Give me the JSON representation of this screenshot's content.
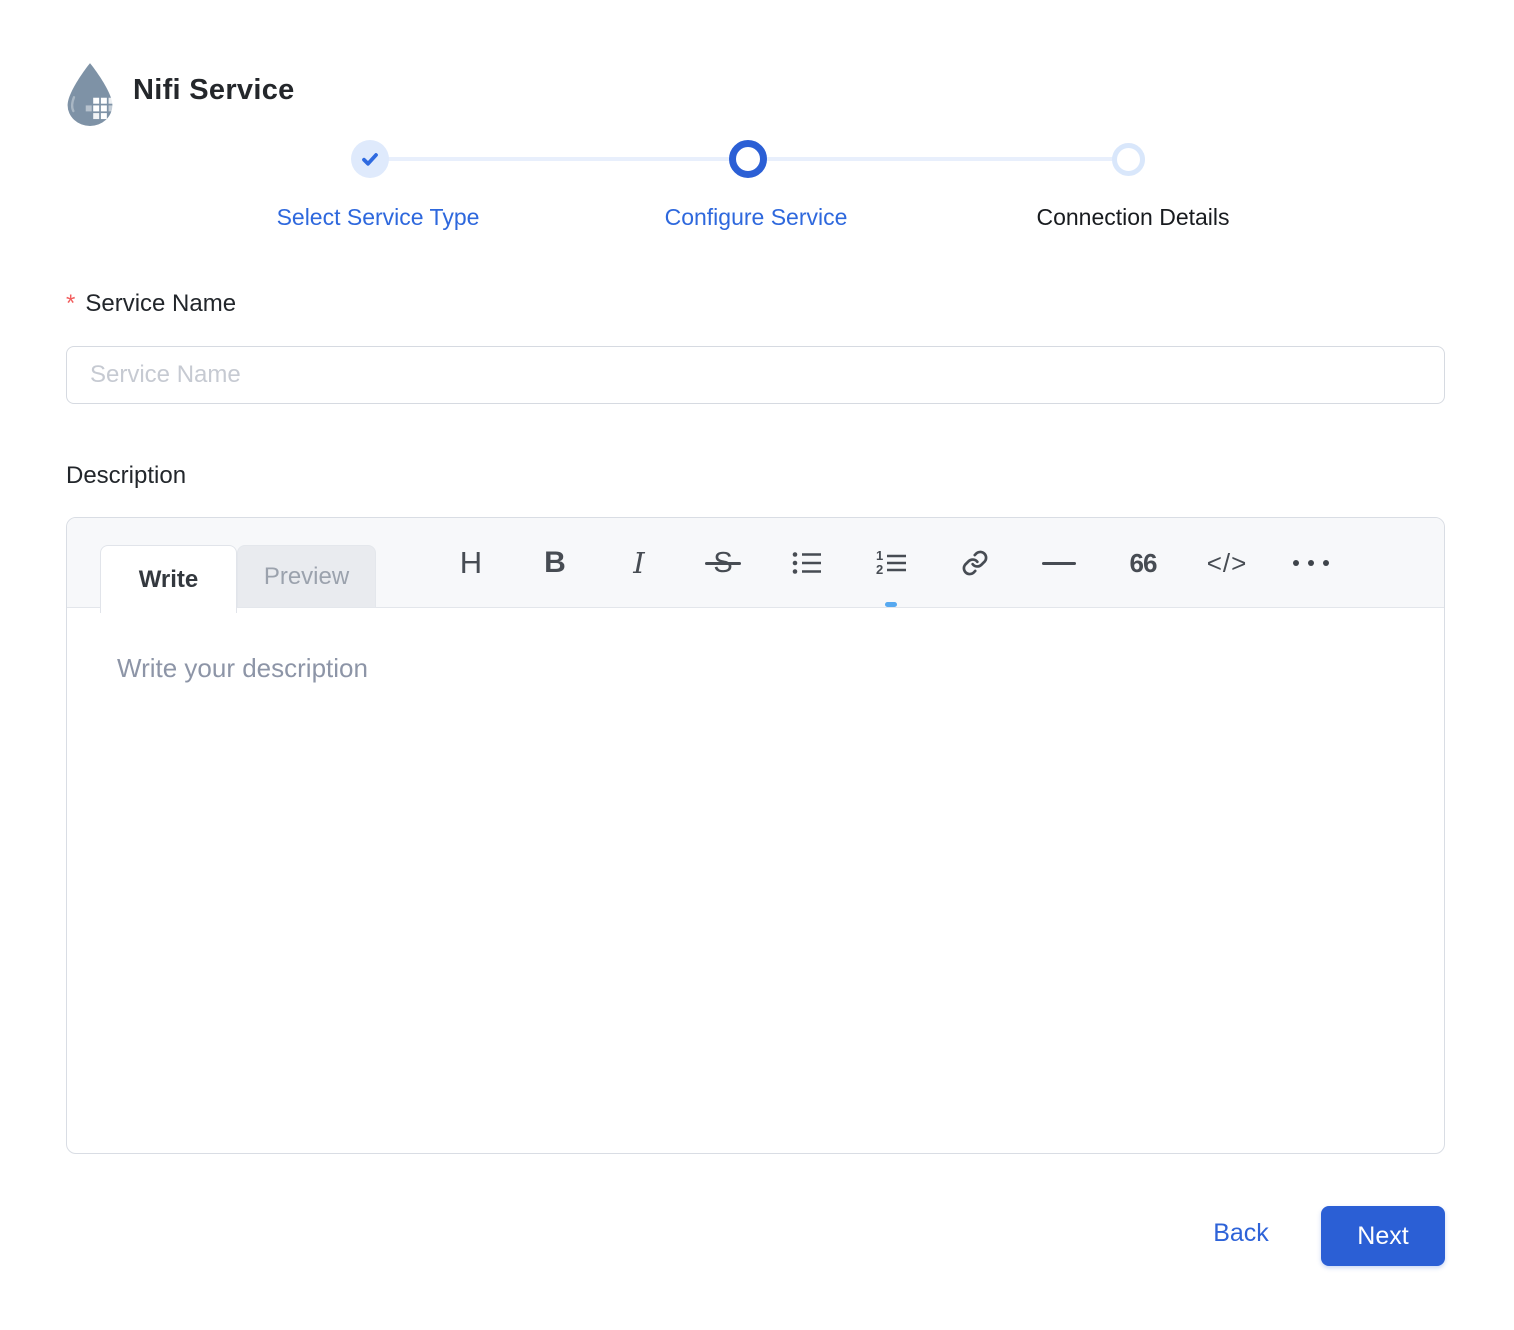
{
  "page": {
    "title": "Nifi Service"
  },
  "stepper": {
    "steps": [
      {
        "label": "Select Service Type",
        "state": "completed"
      },
      {
        "label": "Configure Service",
        "state": "active"
      },
      {
        "label": "Connection Details",
        "state": "upcoming"
      }
    ]
  },
  "service_name": {
    "label": "Service Name",
    "required_marker": "*",
    "placeholder": "Service Name",
    "value": ""
  },
  "description": {
    "label": "Description",
    "tabs": {
      "write": "Write",
      "preview": "Preview"
    },
    "toolbar": {
      "heading": "H",
      "bold": "B",
      "italic": "I",
      "strikethrough": "S",
      "quote": "66",
      "code": "</>",
      "icons": [
        "heading-icon",
        "bold-icon",
        "italic-icon",
        "strikethrough-icon",
        "unordered-list-icon",
        "ordered-list-icon",
        "link-icon",
        "horizontal-rule-icon",
        "quote-icon",
        "code-icon",
        "more-icon"
      ]
    },
    "placeholder": "Write your description",
    "value": ""
  },
  "footer": {
    "back": "Back",
    "next": "Next"
  },
  "colors": {
    "primary": "#2b5fd5",
    "primary_light": "#dfeafc",
    "step_label_active": "#2e68dd",
    "required": "#f25e5e",
    "input_placeholder": "#c6cad2",
    "editor_placeholder": "#8d95a7",
    "toolbar_icon": "#474c53",
    "editor_header_bg": "#f7f8fa",
    "droplet": "#7e92a6"
  }
}
